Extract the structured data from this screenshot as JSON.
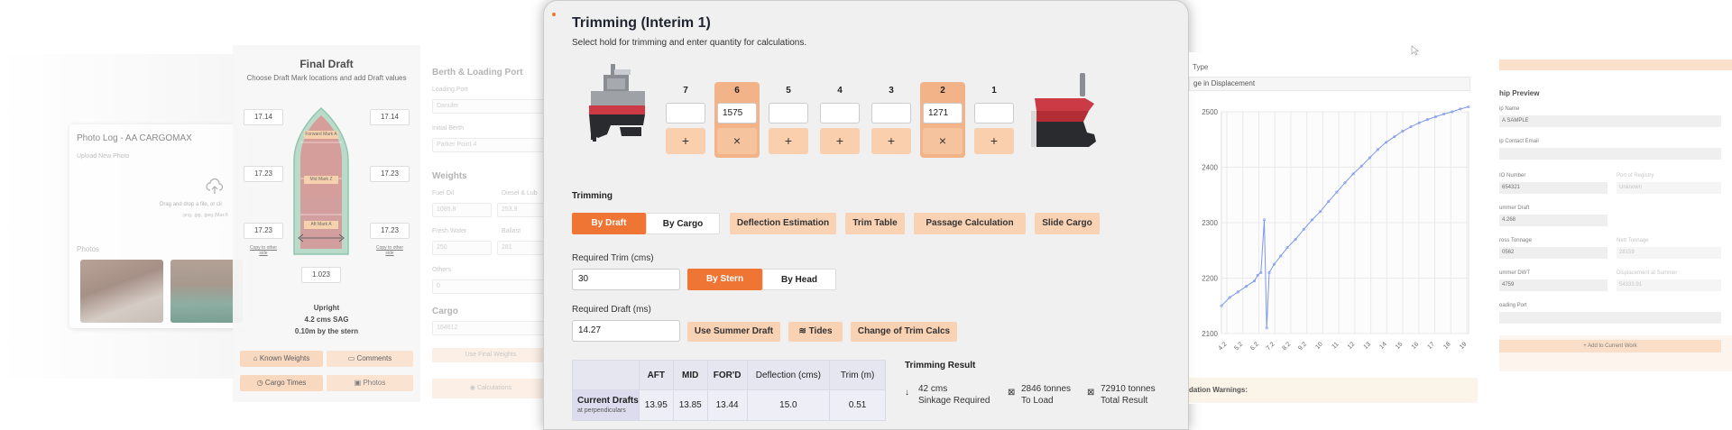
{
  "photo_log": {
    "title": "Photo Log - AA CARGOMAX",
    "upload_label": "Upload New Photo",
    "drag_text": "Drag and drop a file, or cli",
    "file_types": ".png, .jpg, .jpeg (Max fi",
    "photos_label": "Photos"
  },
  "final_draft": {
    "title": "Final Draft",
    "subtitle": "Choose Draft Mark locations and add Draft values",
    "left_values": [
      "17.14",
      "17.23",
      "17.23"
    ],
    "right_values": [
      "17.14",
      "17.23",
      "17.23"
    ],
    "bottom_value": "1.023",
    "copy_left": "Copy to other side",
    "copy_right": "Copy to other side",
    "marks": [
      "Forward Mark A",
      "Mid Mark Z",
      "Aft Mark A"
    ],
    "status_upright": "Upright",
    "status_sag": "4.2 cms SAG",
    "status_stern": "0.10m by the stern",
    "buttons": {
      "known_weights": "Known Weights",
      "comments": "Comments",
      "cargo_times": "Cargo Times",
      "photos": "Photos"
    }
  },
  "berth": {
    "title": "Berth & Loading Port",
    "loading_port_label": "Loading Port",
    "loading_port_value": "Danuler",
    "initial_berth_label": "Initial Berth",
    "initial_berth_value": "Parker Point 4",
    "weights_title": "Weights",
    "fuel_oil_label": "Fuel Oil",
    "fuel_oil_value": "1085.8",
    "diesel_label": "Diesel & Lub",
    "diesel_value": "253.9",
    "fresh_water_label": "Fresh Water",
    "fresh_water_value": "250",
    "ballast_label": "Ballast",
    "ballast_value": "281",
    "others_label": "Others",
    "others_value": "0",
    "cargo_title": "Cargo",
    "cargo_value": "164612",
    "use_final_weights": "Use Final Weights",
    "calculations": "Calculations"
  },
  "modal": {
    "title": "Trimming (Interim 1)",
    "subtitle": "Select hold for trimming and enter quantity for calculations.",
    "holds": [
      {
        "num": "7",
        "value": "",
        "selected": false,
        "action": "+"
      },
      {
        "num": "6",
        "value": "1575",
        "selected": true,
        "action": "×"
      },
      {
        "num": "5",
        "value": "",
        "selected": false,
        "action": "+"
      },
      {
        "num": "4",
        "value": "",
        "selected": false,
        "action": "+"
      },
      {
        "num": "3",
        "value": "",
        "selected": false,
        "action": "+"
      },
      {
        "num": "2",
        "value": "1271",
        "selected": true,
        "action": "×"
      },
      {
        "num": "1",
        "value": "",
        "selected": false,
        "action": "+"
      }
    ],
    "trimming_label": "Trimming",
    "tabs": {
      "by_draft": "By Draft",
      "by_cargo": "By Cargo",
      "deflection": "Deflection Estimation",
      "trim_table": "Trim Table",
      "passage": "Passage Calculation",
      "slide_cargo": "Slide Cargo"
    },
    "required_trim_label": "Required Trim (cms)",
    "required_trim_value": "30",
    "by_stern": "By Stern",
    "by_head": "By Head",
    "required_draft_label": "Required Draft (ms)",
    "required_draft_value": "14.27",
    "use_summer_draft": "Use Summer Draft",
    "tides": "Tides",
    "change_trim_calcs": "Change of Trim Calcs",
    "table": {
      "headers": [
        "AFT",
        "MID",
        "FOR'D",
        "Deflection (cms)",
        "Trim (m)"
      ],
      "row_title": "Current Drafts",
      "row_sub": "at perpendiculars",
      "values": [
        "13.95",
        "13.85",
        "13.44",
        "15.0",
        "0.51"
      ]
    },
    "result_title": "Trimming Result",
    "results": [
      {
        "icon": "arrow-down-icon",
        "line1": "42 cms",
        "line2": "Sinkage Required"
      },
      {
        "icon": "weight-icon",
        "line1": "2846 tonnes",
        "line2": "To Load"
      },
      {
        "icon": "weight-icon",
        "line1": "72910 tonnes",
        "line2": "Total Result"
      }
    ]
  },
  "chart_panel": {
    "type_label": "Type",
    "select_value": "ge in Displacement",
    "footer": "dation Warnings:"
  },
  "chart_data": {
    "type": "line",
    "title": "",
    "xlabel": "",
    "ylabel": "",
    "ylim": [
      2100,
      2500
    ],
    "yticks": [
      2100,
      2200,
      2300,
      2400,
      2500
    ],
    "xticks": [
      "4.2",
      "5.2",
      "6.2",
      "7.2",
      "8.2",
      "9.2",
      "10",
      "11",
      "12",
      "13",
      "14",
      "15",
      "16",
      "17",
      "18",
      "19"
    ],
    "series": [
      {
        "values": [
          [
            0,
            2150
          ],
          [
            0.5,
            2165
          ],
          [
            1,
            2175
          ],
          [
            1.5,
            2185
          ],
          [
            2,
            2195
          ],
          [
            2.2,
            2205
          ],
          [
            2.4,
            2210
          ],
          [
            2.6,
            2305
          ],
          [
            2.75,
            2110
          ],
          [
            2.9,
            2210
          ],
          [
            3.2,
            2225
          ],
          [
            3.6,
            2240
          ],
          [
            4,
            2255
          ],
          [
            4.5,
            2270
          ],
          [
            5,
            2288
          ],
          [
            5.5,
            2305
          ],
          [
            6,
            2320
          ],
          [
            6.5,
            2338
          ],
          [
            7,
            2355
          ],
          [
            7.5,
            2372
          ],
          [
            8,
            2388
          ],
          [
            8.5,
            2402
          ],
          [
            9,
            2417
          ],
          [
            9.5,
            2432
          ],
          [
            10,
            2445
          ],
          [
            10.5,
            2455
          ],
          [
            11,
            2465
          ],
          [
            11.5,
            2473
          ],
          [
            12,
            2480
          ],
          [
            12.5,
            2486
          ],
          [
            13,
            2491
          ],
          [
            13.5,
            2496
          ],
          [
            14,
            2500
          ],
          [
            14.5,
            2505
          ],
          [
            15,
            2509
          ]
        ]
      }
    ],
    "colors": {
      "line": "#6f8de8",
      "grid": "#e8e8e8"
    }
  },
  "ship_preview": {
    "title": "hip Preview",
    "fields": [
      {
        "label": "ip Name",
        "value": "A SAMPLE"
      },
      {
        "label": "ip Contact Email",
        "value": ""
      },
      {
        "label": "IO Number",
        "value": "654321"
      },
      {
        "label": "ummer Draft",
        "value": "4.268"
      },
      {
        "label": "ross Tonnage",
        "value": "0562"
      },
      {
        "label": "ummer DWT",
        "value": "4759"
      },
      {
        "label": "oading Port",
        "value": ""
      }
    ],
    "side_fields": [
      {
        "label": "Port of Registry",
        "value": "Unknown"
      },
      {
        "label": "Nett Tonnage",
        "value": "28159"
      },
      {
        "label": "Displacement at Summer",
        "value": "54333.91"
      }
    ],
    "add_button": "Add to Current Work"
  },
  "colors": {
    "accent": "#ef7535",
    "accent_light": "#f9d1b3",
    "selected_hold": "#f3b388",
    "modal_bg": "#f0f0f0"
  }
}
